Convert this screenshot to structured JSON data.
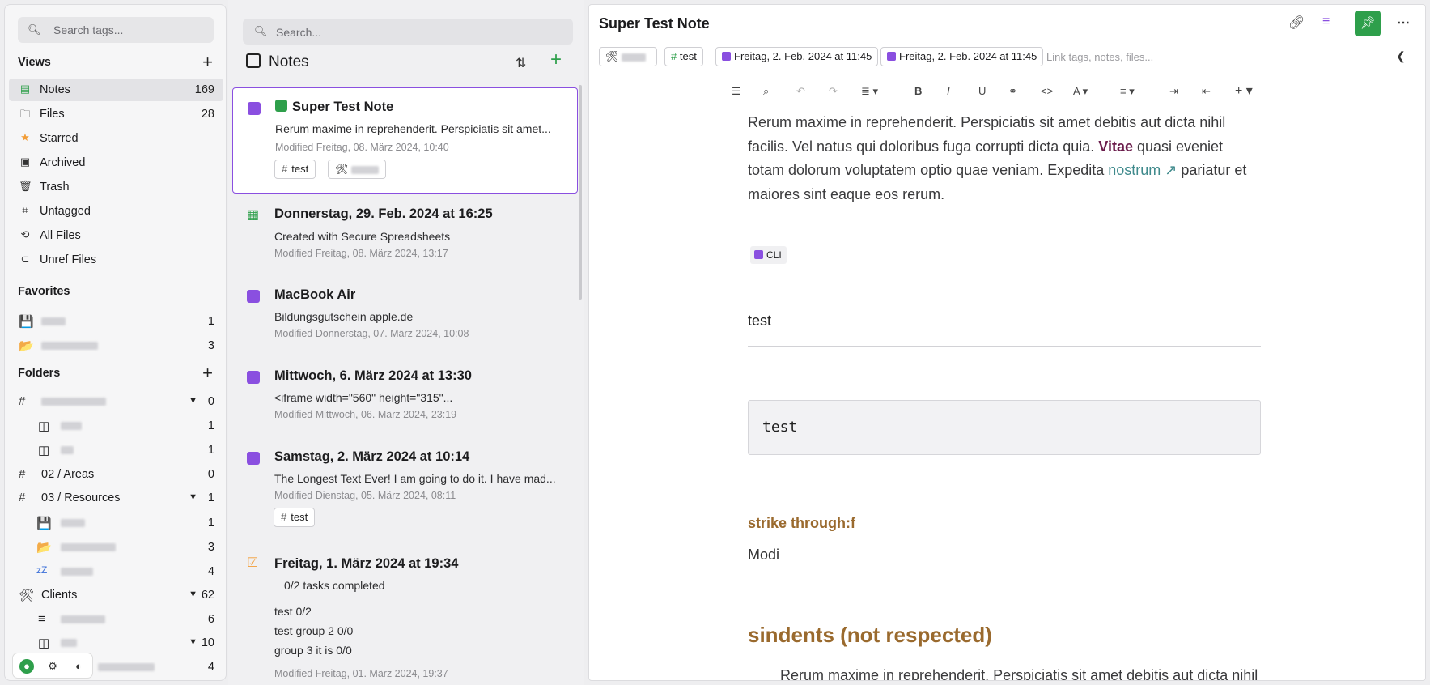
{
  "tags": {
    "search_placeholder": "Search tags...",
    "views_heading": "Views",
    "views": [
      {
        "label": "Notes",
        "count": "169",
        "icon": "notes-icon"
      },
      {
        "label": "Files",
        "count": "28",
        "icon": "folder-icon"
      },
      {
        "label": "Starred",
        "count": "",
        "icon": "star-icon"
      },
      {
        "label": "Archived",
        "count": "",
        "icon": "archive-icon"
      },
      {
        "label": "Trash",
        "count": "",
        "icon": "trash-icon"
      },
      {
        "label": "Untagged",
        "count": "",
        "icon": "untagged-icon"
      },
      {
        "label": "All Files",
        "count": "",
        "icon": "history-icon"
      },
      {
        "label": "Unref Files",
        "count": "",
        "icon": "paperclip-icon"
      }
    ],
    "favorites_heading": "Favorites",
    "favorites": [
      {
        "count": "1"
      },
      {
        "count": "3"
      }
    ],
    "folders_heading": "Folders",
    "folders": [
      {
        "label": "",
        "count": "0"
      },
      {
        "label": "",
        "count": "1"
      },
      {
        "label": "",
        "count": "1"
      },
      {
        "label": "02 / Areas",
        "count": "0"
      },
      {
        "label": "03 / Resources",
        "count": "1"
      },
      {
        "label": "",
        "count": "1"
      },
      {
        "label": "",
        "count": "3"
      },
      {
        "label": "",
        "count": "4"
      },
      {
        "label": "Clients",
        "count": "62"
      },
      {
        "label": "",
        "count": "6"
      },
      {
        "label": "",
        "count": "10"
      },
      {
        "label": "",
        "count": "4"
      }
    ]
  },
  "list": {
    "search_placeholder": "Search...",
    "heading": "Notes",
    "notes": [
      {
        "title": "Super Test Note",
        "preview": "Rerum maxime in reprehenderit. Perspiciatis sit amet...",
        "modified": "Modified Freitag, 08. März 2024, 10:40",
        "tag": "test"
      },
      {
        "title": "Donnerstag, 29. Feb. 2024 at 16:25",
        "preview": "Created with Secure Spreadsheets",
        "modified": "Modified Freitag, 08. März 2024, 13:17"
      },
      {
        "title": "MacBook Air",
        "preview": "Bildungsgutschein apple.de",
        "modified": "Modified Donnerstag, 07. März 2024, 10:08"
      },
      {
        "title": "Mittwoch, 6. März 2024 at 13:30",
        "preview": "<iframe width=\"560\" height=\"315\"...",
        "modified": "Modified Mittwoch, 06. März 2024, 23:19"
      },
      {
        "title": "Samstag, 2. März 2024 at 10:14",
        "preview": "The Longest Text Ever! I am going to do it. I have mad...",
        "modified": "Modified Dienstag, 05. März 2024, 08:11",
        "tag": "test"
      },
      {
        "title": "Freitag, 1. März 2024 at 19:34",
        "tasks": "0/2 tasks completed",
        "groups": [
          "test  0/2",
          "test group 2   0/0",
          "group 3 it is   0/0"
        ],
        "modified": "Modified Freitag, 01. März 2024, 19:37"
      }
    ]
  },
  "editor": {
    "title": "Super Test Note",
    "chips": [
      "test",
      "Freitag, 2. Feb. 2024 at 11:45",
      "Freitag, 2. Feb. 2024 at 11:45"
    ],
    "link_placeholder": "Link tags, notes, files...",
    "p1_a": "Rerum maxime in reprehenderit. Perspiciatis sit amet debitis aut dicta nihil facilis. Vel natus qui ",
    "p1_strike": "doloribus",
    "p1_b": " fuga corrupti dicta quia. ",
    "p1_bold": "Vitae",
    "p1_c": " quasi eveniet totam dolorum voluptatem optio quae veniam. Expedita ",
    "p1_link": "nostrum ↗",
    "p1_d": " pariatur et maiores sint eaque eos rerum.",
    "cli": "CLI",
    "heading_test": "test",
    "code": "test",
    "h3": "strike through:f",
    "modi": "Modi",
    "h2": "sindents (not respected)",
    "indent_text": "Rerum maxime in reprehenderit. Perspiciatis sit amet debitis aut dicta nihil",
    "accent": "#8a4fe0",
    "green": "#2e9f4b"
  }
}
